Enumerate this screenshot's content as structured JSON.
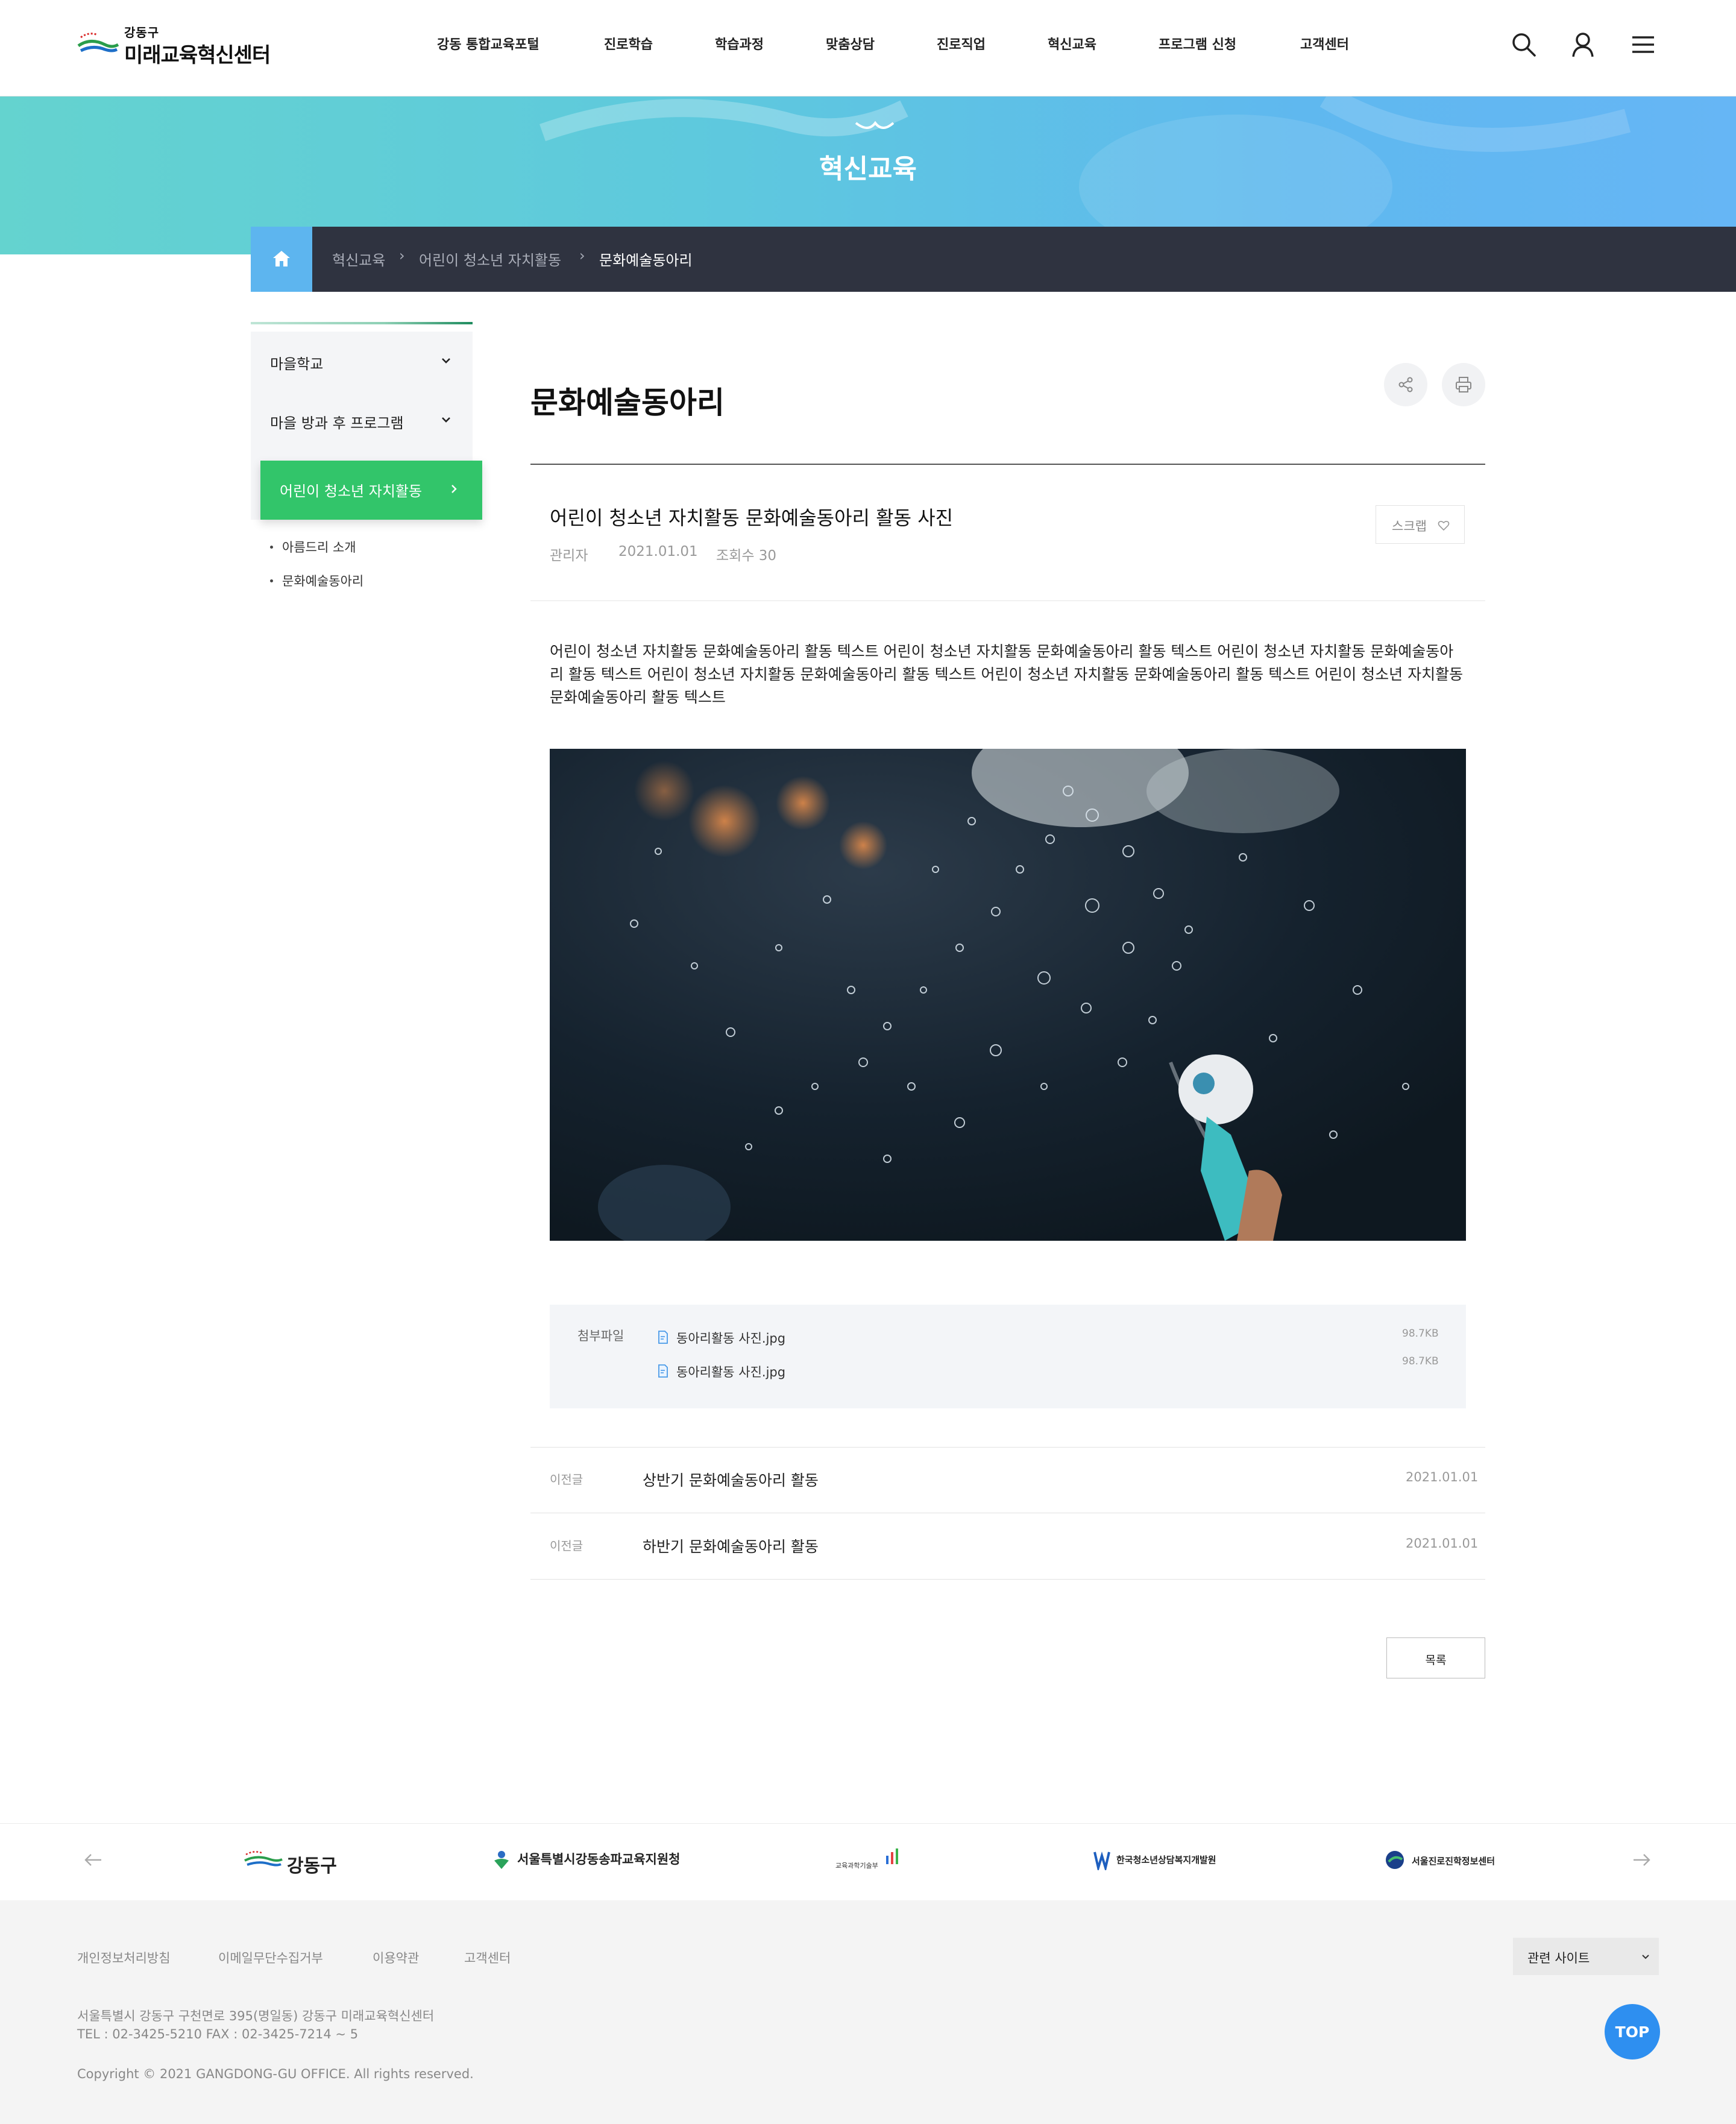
{
  "header": {
    "logo_small": "강동구",
    "logo_big": "미래교육혁신센터",
    "nav": [
      "강동 통합교육포털",
      "진로학습",
      "학습과정",
      "맞춤상담",
      "진로직업",
      "혁신교육",
      "프로그램 신청",
      "고객센터"
    ],
    "icons": [
      "search-icon",
      "user-icon",
      "menu-icon"
    ]
  },
  "banner": {
    "title": "혁신교육"
  },
  "breadcrumb": {
    "items": [
      "혁신교육",
      "어린이 청소년 자치활동",
      "문화예술동아리"
    ]
  },
  "lnb": {
    "items": [
      {
        "label": "마을학교"
      },
      {
        "label": "마을 방과 후 프로그램"
      }
    ],
    "active": "어린이 청소년 자치활동",
    "sub": [
      "아름드리 소개",
      "문화예술동아리"
    ]
  },
  "content": {
    "title": "문화예술동아리",
    "post": {
      "title": "어린이 청소년 자치활동 문화예술동아리 활동 사진",
      "author": "관리자",
      "date": "2021.01.01",
      "views": "조회수 30",
      "scrap": "스크랩",
      "body": "어린이 청소년 자치활동 문화예술동아리 활동 텍스트 어린이 청소년 자치활동 문화예술동아리 활동 텍스트 어린이 청소년 자치활동 문화예술동아리 활동 텍스트 어린이 청소년 자치활동 문화예술동아리 활동 텍스트 어린이 청소년 자치활동 문화예술동아리 활동 텍스트 어린이 청소년 자치활동 문화예술동아리 활동 텍스트"
    },
    "attachments": {
      "label": "첨부파일",
      "files": [
        {
          "name": "동아리활동 사진.jpg",
          "size": "98.7KB"
        },
        {
          "name": "동아리활동 사진.jpg",
          "size": "98.7KB"
        }
      ]
    },
    "nav": [
      {
        "label": "이전글",
        "title": "상반기 문화예술동아리 활동",
        "date": "2021.01.01"
      },
      {
        "label": "이전글",
        "title": "하반기 문화예술동아리 활동",
        "date": "2021.01.01"
      }
    ],
    "list_button": "목록"
  },
  "partners": [
    "강동구",
    "서울특별시강동송파교육지원청",
    "교육과학기술부",
    "한국청소년상담복지개발원",
    "서울진로진학정보센터"
  ],
  "footer": {
    "links": [
      "개인정보처리방침",
      "이메일무단수집거부",
      "이용약관",
      "고객센터"
    ],
    "related": "관련 사이트",
    "address": "서울특별시 강동구 구천면로 395(명일동) 강동구 미래교육혁신센터",
    "tel": "TEL : 02-3425-5210 FAX : 02-3425-7214 ~ 5",
    "copyright": "Copyright © 2021 GANGDONG-GU OFFICE. All rights reserved.",
    "top": "TOP"
  },
  "colors": {
    "accent_green": "#32c56a",
    "breadcrumb_bg": "#2f3340",
    "home_blue": "#5db5ef",
    "top_button": "#2e8ff0"
  }
}
